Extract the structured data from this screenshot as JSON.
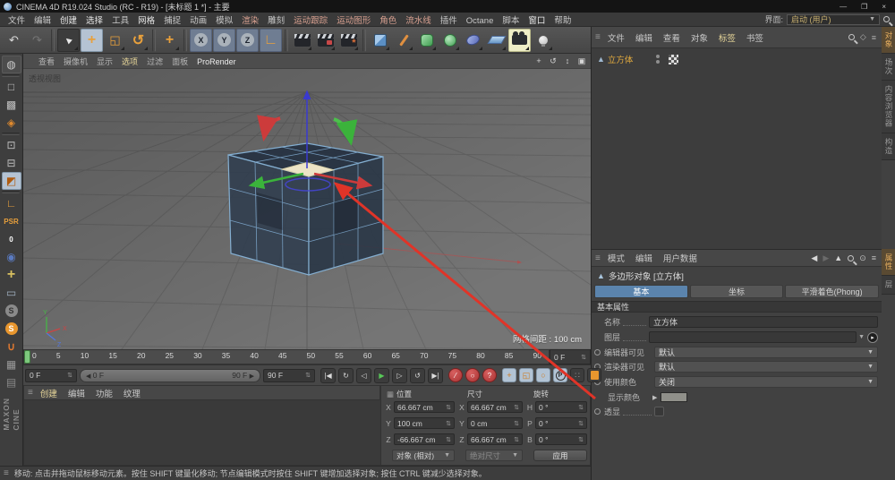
{
  "titlebar": {
    "title": "CINEMA 4D R19.024 Studio (RC - R19) - [未标题 1 *] - 主要",
    "min": "—",
    "max": "❐",
    "close": "×"
  },
  "menubar": {
    "items": [
      {
        "label": "文件",
        "fg": "#c8c8c8"
      },
      {
        "label": "编辑",
        "fg": "#c8c8c8"
      },
      {
        "label": "创建",
        "fg": "#e8e8e8"
      },
      {
        "label": "选择",
        "fg": "#e8e8e8"
      },
      {
        "label": "工具",
        "fg": "#c8c8c8"
      },
      {
        "label": "网格",
        "fg": "#e8e8e8"
      },
      {
        "label": "捕捉",
        "fg": "#c8c8c8"
      },
      {
        "label": "动画",
        "fg": "#c8c8c8"
      },
      {
        "label": "模拟",
        "fg": "#c8c8c8"
      },
      {
        "label": "渲染",
        "fg": "#d8a090"
      },
      {
        "label": "雕刻",
        "fg": "#c8c8c8"
      },
      {
        "label": "运动跟踪",
        "fg": "#d8a090"
      },
      {
        "label": "运动图形",
        "fg": "#d8a090"
      },
      {
        "label": "角色",
        "fg": "#d8a090"
      },
      {
        "label": "流水线",
        "fg": "#d8a090"
      },
      {
        "label": "插件",
        "fg": "#c8c8c8"
      },
      {
        "label": "Octane",
        "fg": "#c8c8c8"
      },
      {
        "label": "脚本",
        "fg": "#c8c8c8"
      },
      {
        "label": "窗口",
        "fg": "#e8e8e8"
      },
      {
        "label": "帮助",
        "fg": "#c8c8c8"
      }
    ],
    "interface_label": "界面:",
    "interface_value": "启动 (用户)"
  },
  "toolbar": {
    "items": [
      {
        "name": "undo-button",
        "glyph": "↶",
        "fg": "#d8d8d8"
      },
      {
        "name": "redo-button",
        "glyph": "↷",
        "fg": "#767676"
      },
      {
        "cls": "sep"
      },
      {
        "name": "select-tool-button",
        "glyph": "▲",
        "icls": "g cursor",
        "fg": "#e8e8e8",
        "cls": "darkbg more"
      },
      {
        "name": "move-tool-button",
        "glyph": "+",
        "fg": "#e8a03c",
        "cls": "active-blue",
        "icls": "g big"
      },
      {
        "name": "scale-tool-button",
        "glyph": "◱",
        "fg": "#e8a03c",
        "cls": "more"
      },
      {
        "name": "rotate-tool-button",
        "glyph": "↺",
        "fg": "#e8a03c",
        "icls": "g big",
        "cls": "more"
      },
      {
        "cls": "sep"
      },
      {
        "name": "last-tool-button",
        "glyph": "+",
        "fg": "#e8a03c",
        "icls": "g big",
        "cls": "more"
      },
      {
        "cls": "sep"
      },
      {
        "name": "x-axis-lock-button",
        "glyph": "X",
        "icls": "g axisc",
        "cls": "axisbg"
      },
      {
        "name": "y-axis-lock-button",
        "glyph": "Y",
        "icls": "g axisc",
        "cls": "axisbg"
      },
      {
        "name": "z-axis-lock-button",
        "glyph": "Z",
        "icls": "g axisc",
        "cls": "axisbg"
      },
      {
        "name": "coord-system-button",
        "glyph": "∟",
        "fg": "#e8a03c",
        "cls": "axisbg",
        "icls": "g big"
      },
      {
        "cls": "sep"
      },
      {
        "name": "render-view-button",
        "icls": "g clap",
        "cls": "more"
      },
      {
        "name": "render-region-button",
        "icls": "g clap red",
        "cls": "more"
      },
      {
        "name": "render-settings-button",
        "icls": "g clap gear",
        "cls": "more"
      },
      {
        "cls": "sep"
      },
      {
        "name": "add-cube-button",
        "icls": "g cubeic",
        "cls": "more"
      },
      {
        "name": "spline-pen-button",
        "icls": "g penic",
        "cls": "more"
      },
      {
        "name": "subdivision-surface-button",
        "icls": "g subdivic",
        "cls": "more"
      },
      {
        "name": "deformer-button",
        "icls": "g deformic",
        "cls": "more"
      },
      {
        "name": "volume-button",
        "icls": "g blobic",
        "cls": "more"
      },
      {
        "name": "floor-button",
        "icls": "g flooric",
        "cls": "more"
      },
      {
        "name": "camera-button",
        "icls": "g camic",
        "cls": "active-yellow more"
      },
      {
        "name": "light-button",
        "icls": "g bulbic",
        "cls": "more"
      }
    ]
  },
  "leftbar": {
    "items": [
      {
        "name": "make-editable-button",
        "glyph": "◍",
        "fg": "#c8c8c8",
        "cls": "lit"
      },
      {
        "cls": "lsep"
      },
      {
        "name": "model-mode-button",
        "glyph": "□",
        "fg": "#c0c0c0"
      },
      {
        "name": "texture-mode-button",
        "glyph": "▩",
        "fg": "#c0c0c0"
      },
      {
        "name": "workplane-mode-button",
        "glyph": "◈",
        "fg": "#e08a2e"
      },
      {
        "cls": "lsep"
      },
      {
        "name": "points-mode-button",
        "glyph": "⊡",
        "fg": "#c0c0c0"
      },
      {
        "name": "edges-mode-button",
        "glyph": "⊟",
        "fg": "#c0c0c0"
      },
      {
        "name": "polygons-mode-button",
        "glyph": "◩",
        "fg": "#b05c10",
        "cls": "active-blue"
      },
      {
        "cls": "lsep"
      },
      {
        "name": "enable-axis-button",
        "glyph": "∟",
        "fg": "#e8a03c"
      },
      {
        "name": "psr-label",
        "glyph": "PSR",
        "icls": "g txt org"
      },
      {
        "name": "psr-zero-label",
        "glyph": "0",
        "icls": "g txt wht"
      },
      {
        "name": "snap-move-icon",
        "glyph": "◉",
        "fg": "#5a7ac0"
      },
      {
        "name": "workplane-center-icon",
        "glyph": "+",
        "fg": "#d8c060",
        "icls": "g big"
      },
      {
        "name": "viewport-solo-button",
        "glyph": "▭",
        "fg": "#a0b0c0"
      },
      {
        "name": "snap-disabled-button",
        "glyph": "S",
        "icls": "g scirc off"
      },
      {
        "name": "snap-enabled-button",
        "glyph": "S",
        "icls": "g scirc on"
      },
      {
        "name": "magnet-snap-button",
        "glyph": "∪",
        "fg": "#e07830",
        "icls": "g bold"
      },
      {
        "name": "workplane-lock-button",
        "glyph": "▦",
        "fg": "#9a9a9a"
      },
      {
        "name": "workplane-align-button",
        "glyph": "▤",
        "fg": "#8a8a8a"
      }
    ],
    "logo_top": "MAXON",
    "logo_bottom": "CINE"
  },
  "viewport": {
    "menu": [
      {
        "label": "查看",
        "fg": "#b4b4b4"
      },
      {
        "label": "摄像机",
        "fg": "#b4b4b4"
      },
      {
        "label": "显示",
        "fg": "#b4b4b4"
      },
      {
        "label": "选项",
        "fg": "#e8d79a"
      },
      {
        "label": "过滤",
        "fg": "#b4b4b4"
      },
      {
        "label": "面板",
        "fg": "#b4b4b4"
      },
      {
        "label": "ProRender",
        "fg": "#ececec"
      }
    ],
    "corner_icons": [
      {
        "name": "pan-icon",
        "glyph": "+"
      },
      {
        "name": "orbit-icon",
        "glyph": "↺"
      },
      {
        "name": "dolly-icon",
        "glyph": "↕"
      },
      {
        "name": "toggle-view-icon",
        "glyph": "▣"
      }
    ],
    "view_label": "透视视图",
    "grid_label": "网格间距 : 100 cm",
    "axis_x": "X",
    "axis_y": "Y",
    "axis_z": "Z"
  },
  "object_manager": {
    "menu": [
      {
        "label": "文件",
        "fg": "#c8c8c8"
      },
      {
        "label": "编辑",
        "fg": "#c8c8c8"
      },
      {
        "label": "查看",
        "fg": "#c8c8c8"
      },
      {
        "label": "对象",
        "fg": "#c8c8c8"
      },
      {
        "label": "标签",
        "fg": "#e8d79a"
      },
      {
        "label": "书签",
        "fg": "#c8c8c8"
      }
    ],
    "icons": [
      {
        "name": "search-icon",
        "icls": "g magic"
      },
      {
        "name": "shield-icon",
        "glyph": "◇",
        "fg": "#b0b0b0"
      },
      {
        "name": "filter-icon",
        "glyph": "≡",
        "fg": "#b0b0b0"
      }
    ],
    "object_name": "立方体"
  },
  "side_tabs_upper": [
    {
      "label": "对象",
      "active": true,
      "name": "tab-objects"
    },
    {
      "label": "场次",
      "name": "tab-takes"
    },
    {
      "label": "内容浏览器",
      "name": "tab-content-browser"
    },
    {
      "label": "构造",
      "name": "tab-structure"
    }
  ],
  "side_tabs_lower": [
    {
      "label": "属性",
      "active": true,
      "name": "tab-attributes"
    },
    {
      "label": "层",
      "name": "tab-layers"
    }
  ],
  "attributes": {
    "menu": [
      {
        "label": "模式",
        "fg": "#c8c8c8"
      },
      {
        "label": "编辑",
        "fg": "#c8c8c8"
      },
      {
        "label": "用户数据",
        "fg": "#c8c8c8"
      }
    ],
    "icons": [
      {
        "name": "back-icon",
        "glyph": "◀",
        "fg": "#d8d8d8"
      },
      {
        "name": "forward-icon",
        "glyph": "▶",
        "fg": "#6a6a6a"
      },
      {
        "name": "up-icon",
        "glyph": "▲",
        "fg": "#d8d8d8"
      },
      {
        "name": "search-icon",
        "icls": "g magic"
      },
      {
        "name": "lock-icon",
        "glyph": "⊙",
        "fg": "#c0c0c0"
      },
      {
        "name": "menu-icon",
        "glyph": "≡",
        "fg": "#c0c0c0"
      }
    ],
    "title": "多边形对象 [立方体]",
    "tabs": [
      {
        "label": "基本",
        "active": true
      },
      {
        "label": "坐标"
      },
      {
        "label": "平滑着色(Phong)"
      }
    ],
    "section": "基本属性",
    "name_label": "名称",
    "name_value": "立方体",
    "layer_label": "图层",
    "editor_label": "编辑器可见",
    "editor_value": "默认",
    "render_label": "渲染器可见",
    "render_value": "默认",
    "usecolor_label": "使用颜色",
    "usecolor_value": "关闭",
    "displaycolor_label": "显示颜色",
    "xray_label": "透显"
  },
  "timeline": {
    "ticks": [
      "0",
      "5",
      "10",
      "15",
      "20",
      "25",
      "30",
      "35",
      "40",
      "45",
      "50",
      "55",
      "60",
      "65",
      "70",
      "75",
      "80",
      "85",
      "90"
    ],
    "after_ruler": "0 F",
    "current": "0 F",
    "range_start": "0 F",
    "range_end": "90 F",
    "end": "90 F",
    "transport": [
      {
        "name": "goto-start-button",
        "glyph": "|◀"
      },
      {
        "name": "play-reverse-button",
        "glyph": "↻"
      },
      {
        "name": "previous-frame-button",
        "glyph": "◁"
      },
      {
        "name": "play-forward-button",
        "glyph": "▶",
        "grn": true
      },
      {
        "name": "next-frame-button",
        "glyph": "▷"
      },
      {
        "name": "play-loop-button",
        "glyph": "↺"
      },
      {
        "name": "goto-end-button",
        "glyph": "▶|"
      }
    ],
    "record": [
      {
        "name": "record-keyframe-button",
        "glyph": "⁄"
      },
      {
        "name": "autokey-button",
        "glyph": "○"
      },
      {
        "name": "keyframe-options-button",
        "glyph": "?"
      }
    ],
    "toggles": [
      {
        "name": "key-position-toggle",
        "glyph": "+",
        "cls": "on",
        "fg": "#d07818"
      },
      {
        "name": "key-scale-toggle",
        "glyph": "◱",
        "cls": "on",
        "fg": "#d07818"
      },
      {
        "name": "key-rotation-toggle",
        "glyph": "○",
        "cls": "on",
        "fg": "#d07818"
      },
      {
        "name": "key-parameter-toggle",
        "glyph": "P",
        "cls": "on",
        "icls": "g pcirc"
      },
      {
        "name": "key-pla-toggle",
        "glyph": "∷",
        "fg": "#9a9a9a"
      },
      {
        "name": "timeline-film-button",
        "icls": "g filmic"
      }
    ]
  },
  "coords": {
    "grid_icon": "▦",
    "headers": [
      "位置",
      "尺寸",
      "旋转"
    ],
    "pos": [
      {
        "a": "X",
        "v": "66.667 cm"
      },
      {
        "a": "Y",
        "v": "100 cm"
      },
      {
        "a": "Z",
        "v": "-66.667 cm"
      }
    ],
    "size": [
      {
        "a": "X",
        "v": "66.667 cm"
      },
      {
        "a": "Y",
        "v": "0 cm"
      },
      {
        "a": "Z",
        "v": "66.667 cm"
      }
    ],
    "rot": [
      {
        "a": "H",
        "v": "0 °"
      },
      {
        "a": "P",
        "v": "0 °"
      },
      {
        "a": "B",
        "v": "0 °"
      }
    ],
    "mode_object": "对象 (相对)",
    "mode_size": "绝对尺寸",
    "apply": "应用"
  },
  "materials": {
    "menu": [
      {
        "label": "创建",
        "fg": "#e8d79a"
      },
      {
        "label": "编辑",
        "fg": "#c8c8c8"
      },
      {
        "label": "功能",
        "fg": "#c8c8c8"
      },
      {
        "label": "纹理",
        "fg": "#c8c8c8"
      }
    ]
  },
  "statusbar": {
    "text": "移动: 点击并拖动鼠标移动元素。按住 SHIFT 键量化移动; 节点编辑模式时按住 SHIFT 键增加选择对象; 按住 CTRL 键减少选择对象。"
  },
  "colors": {
    "accent_orange": "#e8a03c",
    "selected_blue": "#5b84ad",
    "annotation_red": "#e03428",
    "object_orange": "#e0a93e",
    "selected_face": "#ece4c6"
  }
}
